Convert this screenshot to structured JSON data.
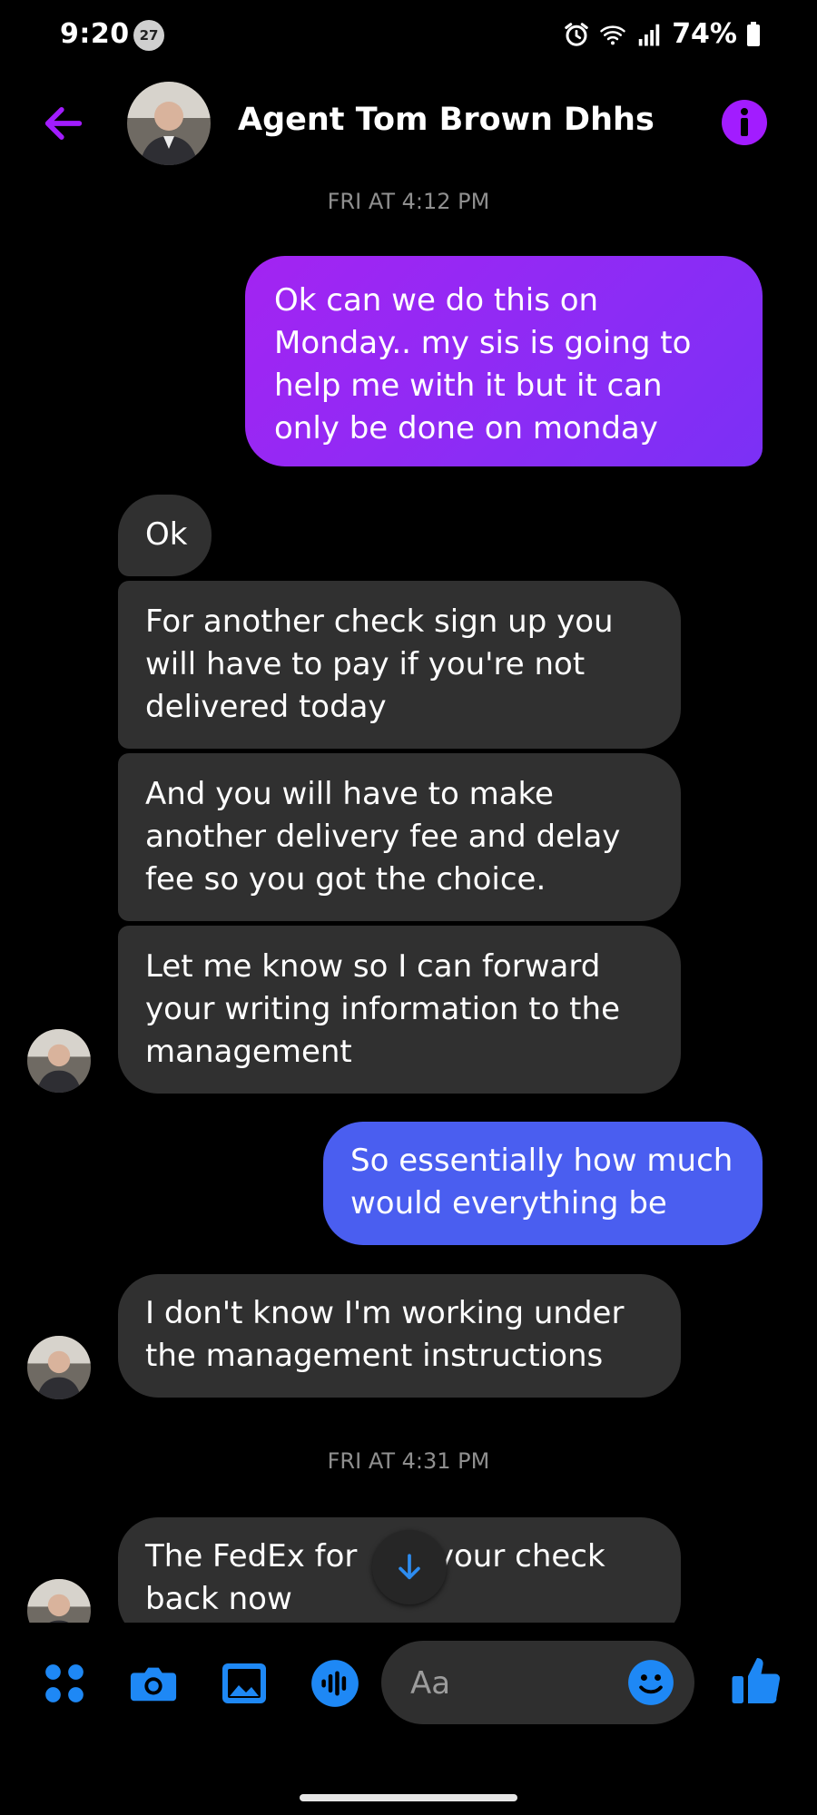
{
  "status_bar": {
    "time": "9:20",
    "notification_count": "27",
    "battery": "74%",
    "icons": [
      "alarm-icon",
      "wifi-icon",
      "signal-icon",
      "battery-icon"
    ]
  },
  "header": {
    "contact_name": "Agent Tom Brown Dhhs",
    "back_icon": "back-arrow-icon",
    "info_icon": "info-icon"
  },
  "colors": {
    "accent_purple": "#a21cff",
    "bubble_incoming": "#303030",
    "bubble_outgoing_blue": "#4a5ef0",
    "toolbar_blue": "#1e88f5"
  },
  "thread": {
    "timestamp_1": "FRI AT 4:12 PM",
    "msg_out_1": "Ok can we do this on Monday.. my sis is going to help me with it but it can only be done on monday",
    "msg_in_1": "Ok",
    "msg_in_2": "For another check sign up you will have to pay if you're not delivered today",
    "msg_in_3": "And you will have to make another delivery fee and delay fee so you got the choice.",
    "msg_in_4": "Let me know so I can forward your writing information to the management",
    "msg_out_2": "So essentially how much would everything  be",
    "msg_in_5": "I don't know I'm working under the management instructions",
    "timestamp_2": "FRI AT 4:31 PM",
    "msg_in_6": "The FedEx for        your check back now"
  },
  "composer": {
    "placeholder": "Aa",
    "tools": [
      "apps-icon",
      "camera-icon",
      "gallery-icon",
      "voice-icon"
    ],
    "emoji_icon": "emoji-icon",
    "like_icon": "thumbs-up-icon"
  }
}
